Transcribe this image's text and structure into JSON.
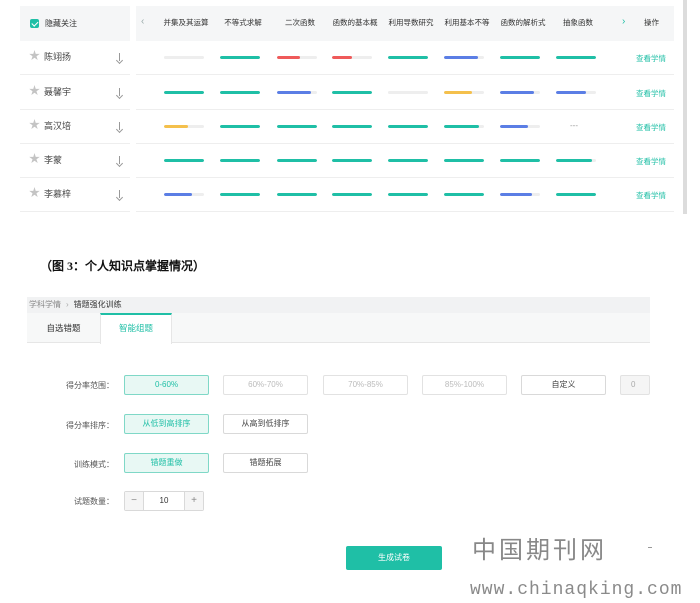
{
  "figure3": {
    "hide_follow_label": "隐藏关注",
    "columns": [
      "并集及其运算",
      "不等式求解",
      "二次函数",
      "函数的基本概",
      "利用导数研究",
      "利用基本不等",
      "函数的解析式",
      "抽象函数"
    ],
    "action_header": "操作",
    "prev_icon": "‹",
    "next_icon": "›",
    "students": [
      {
        "name": "陈翊扬",
        "bars": [
          {
            "pct": 0.1,
            "color": "#eeeeee"
          },
          {
            "pct": 1.0,
            "color": "#1fbfa6"
          },
          {
            "pct": 0.58,
            "color": "#ef5a5a"
          },
          {
            "pct": 0.5,
            "color": "#ef5a5a"
          },
          {
            "pct": 1.0,
            "color": "#1fbfa6"
          },
          {
            "pct": 0.85,
            "color": "#5b7ee5"
          },
          {
            "pct": 1.0,
            "color": "#1fbfa6"
          },
          {
            "pct": 1.0,
            "color": "#1fbfa6"
          }
        ],
        "action": "查看学情"
      },
      {
        "name": "聂馨宇",
        "bars": [
          {
            "pct": 1.0,
            "color": "#1fbfa6"
          },
          {
            "pct": 1.0,
            "color": "#1fbfa6"
          },
          {
            "pct": 0.85,
            "color": "#5b7ee5"
          },
          {
            "pct": 1.0,
            "color": "#1fbfa6"
          },
          {
            "pct": 0.1,
            "color": "#eeeeee"
          },
          {
            "pct": 0.7,
            "color": "#f4c04c"
          },
          {
            "pct": 0.85,
            "color": "#5b7ee5"
          },
          {
            "pct": 0.75,
            "color": "#5b7ee5"
          }
        ],
        "action": "查看学情"
      },
      {
        "name": "高汉培",
        "bars": [
          {
            "pct": 0.6,
            "color": "#f4c04c"
          },
          {
            "pct": 1.0,
            "color": "#1fbfa6"
          },
          {
            "pct": 1.0,
            "color": "#1fbfa6"
          },
          {
            "pct": 1.0,
            "color": "#1fbfa6"
          },
          {
            "pct": 1.0,
            "color": "#1fbfa6"
          },
          {
            "pct": 0.88,
            "color": "#1fbfa6"
          },
          {
            "pct": 0.7,
            "color": "#5b7ee5"
          },
          {
            "pct": null,
            "color": "#999999"
          }
        ],
        "action": "查看学情"
      },
      {
        "name": "李蒙",
        "bars": [
          {
            "pct": 1.0,
            "color": "#1fbfa6"
          },
          {
            "pct": 1.0,
            "color": "#1fbfa6"
          },
          {
            "pct": 1.0,
            "color": "#1fbfa6"
          },
          {
            "pct": 1.0,
            "color": "#1fbfa6"
          },
          {
            "pct": 1.0,
            "color": "#1fbfa6"
          },
          {
            "pct": 1.0,
            "color": "#1fbfa6"
          },
          {
            "pct": 1.0,
            "color": "#1fbfa6"
          },
          {
            "pct": 0.9,
            "color": "#1fbfa6"
          }
        ],
        "action": "查看学情"
      },
      {
        "name": "李慕梓",
        "bars": [
          {
            "pct": 0.7,
            "color": "#5b7ee5"
          },
          {
            "pct": 1.0,
            "color": "#1fbfa6"
          },
          {
            "pct": 1.0,
            "color": "#1fbfa6"
          },
          {
            "pct": 1.0,
            "color": "#1fbfa6"
          },
          {
            "pct": 1.0,
            "color": "#1fbfa6"
          },
          {
            "pct": 1.0,
            "color": "#1fbfa6"
          },
          {
            "pct": 0.8,
            "color": "#5b7ee5"
          },
          {
            "pct": 1.0,
            "color": "#1fbfa6"
          }
        ],
        "action": "查看学情"
      }
    ],
    "empty_mark": "---"
  },
  "caption": "（图 3：个人知识点掌握情况）",
  "figure4": {
    "breadcrumb": {
      "root": "学科学情",
      "sep": "›",
      "current": "错题强化训练"
    },
    "tabs": [
      "自选错题",
      "智能组题"
    ],
    "score_range": {
      "label": "得分率范围：",
      "options": [
        "0-60%",
        "60%-70%",
        "70%-85%",
        "85%-100%",
        "自定义",
        "0"
      ]
    },
    "score_sort": {
      "label": "得分率排序：",
      "options": [
        "从低到高排序",
        "从高到低排序"
      ]
    },
    "train_mode": {
      "label": "训练模式：",
      "options": [
        "错题重做",
        "错题拓展"
      ]
    },
    "count": {
      "label": "试题数量：",
      "minus": "−",
      "value": "10",
      "plus": "+"
    },
    "generate_button": "生成试卷"
  },
  "watermark": {
    "title": "中国期刊网",
    "url": "www.chinaqking.com"
  },
  "colors": {
    "accent": "#1fbfa6",
    "red": "#ef5a5a",
    "blue": "#5b7ee5",
    "yellow": "#f4c04c"
  }
}
